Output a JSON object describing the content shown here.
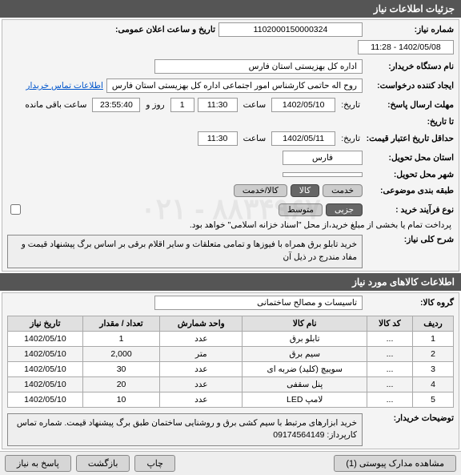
{
  "header": {
    "title": "جزئیات اطلاعات نیاز"
  },
  "form": {
    "need_no_label": "شماره نیاز:",
    "need_no": "1102000150000324",
    "announce_label": "تاریخ و ساعت اعلان عمومی:",
    "announce_value": "1402/05/08 - 11:28",
    "buyer_label": "نام دستگاه خریدار:",
    "buyer": "اداره کل بهزیستی استان فارس",
    "requester_label": "ایجاد کننده درخواست:",
    "requester": "روح اله حاتمی کارشناس امور اجتماعی اداره کل بهزیستی استان فارس",
    "contact_link": "اطلاعات تماس خریدار",
    "reply_deadline_label": "مهلت ارسال پاسخ:",
    "date_label": "تاریخ:",
    "reply_date": "1402/05/10",
    "time_label": "ساعت",
    "reply_time": "11:30",
    "day_label": "روز و",
    "day_count": "1",
    "remaining_label": "ساعت باقی مانده",
    "remaining_time": "23:55:40",
    "to_date_label": "تا تاریخ:",
    "price_valid_label": "حداقل تاریخ اعتبار قیمت:",
    "price_date": "1402/05/11",
    "price_time": "11:30",
    "delivery_prov_label": "استان محل تحویل:",
    "delivery_prov": "فارس",
    "delivery_city_label": "شهر محل تحویل:",
    "subject_class_label": "طبقه بندی موضوعی:",
    "subject_goods": "کالا",
    "subject_service": "خدمت",
    "subject_goods_service": "کالا/خدمت",
    "process_label": "نوع فرآیند خرید :",
    "process_opt1": "جزیی",
    "process_opt2": "متوسط",
    "payment_note": "پرداخت تمام یا بخشی از مبلغ خرید،از محل \"اسناد خزانه اسلامی\" خواهد بود.",
    "need_desc_label": "شرح کلی نیاز:",
    "need_desc": "خرید تابلو برق همراه با فیوزها و تمامی متعلقات و سایر اقلام برقی بر اساس برگ پیشنهاد قیمت و مفاد مندرج در ذیل آن"
  },
  "items_header": "اطلاعات کالاهای مورد نیاز",
  "group_label": "گروه کالا:",
  "group_value": "تاسیسات و مصالح ساختمانی",
  "table": {
    "headers": {
      "row": "ردیف",
      "code": "کد کالا",
      "name": "نام کالا",
      "unit": "واحد شمارش",
      "qty": "تعداد / مقدار",
      "need_date": "تاریخ نیاز"
    },
    "rows": [
      {
        "n": "1",
        "code": "...",
        "name": "تابلو برق",
        "unit": "عدد",
        "qty": "1",
        "date": "1402/05/10"
      },
      {
        "n": "2",
        "code": "...",
        "name": "سیم برق",
        "unit": "متر",
        "qty": "2,000",
        "date": "1402/05/10"
      },
      {
        "n": "3",
        "code": "...",
        "name": "سوییچ (کلید) ضربه ای",
        "unit": "عدد",
        "qty": "30",
        "date": "1402/05/10"
      },
      {
        "n": "4",
        "code": "...",
        "name": "پنل سقفی",
        "unit": "عدد",
        "qty": "20",
        "date": "1402/05/10"
      },
      {
        "n": "5",
        "code": "...",
        "name": "لامپ LED",
        "unit": "عدد",
        "qty": "10",
        "date": "1402/05/10"
      }
    ]
  },
  "buyer_note_label": "توضیحات خریدار:",
  "buyer_note": "خرید ابزارهای مرتبط با سیم کشی برق و روشنایی ساختمان طبق برگ پیشنهاد قیمت. شماره تماس کارپرداز: 09174564149",
  "watermark": "۰۲۱ - ۸۸۳۴۹۶۷",
  "footer": {
    "attachments": "مشاهده مدارک پیوستی (1)",
    "print": "چاپ",
    "back": "بازگشت",
    "answer": "پاسخ به نیاز"
  }
}
